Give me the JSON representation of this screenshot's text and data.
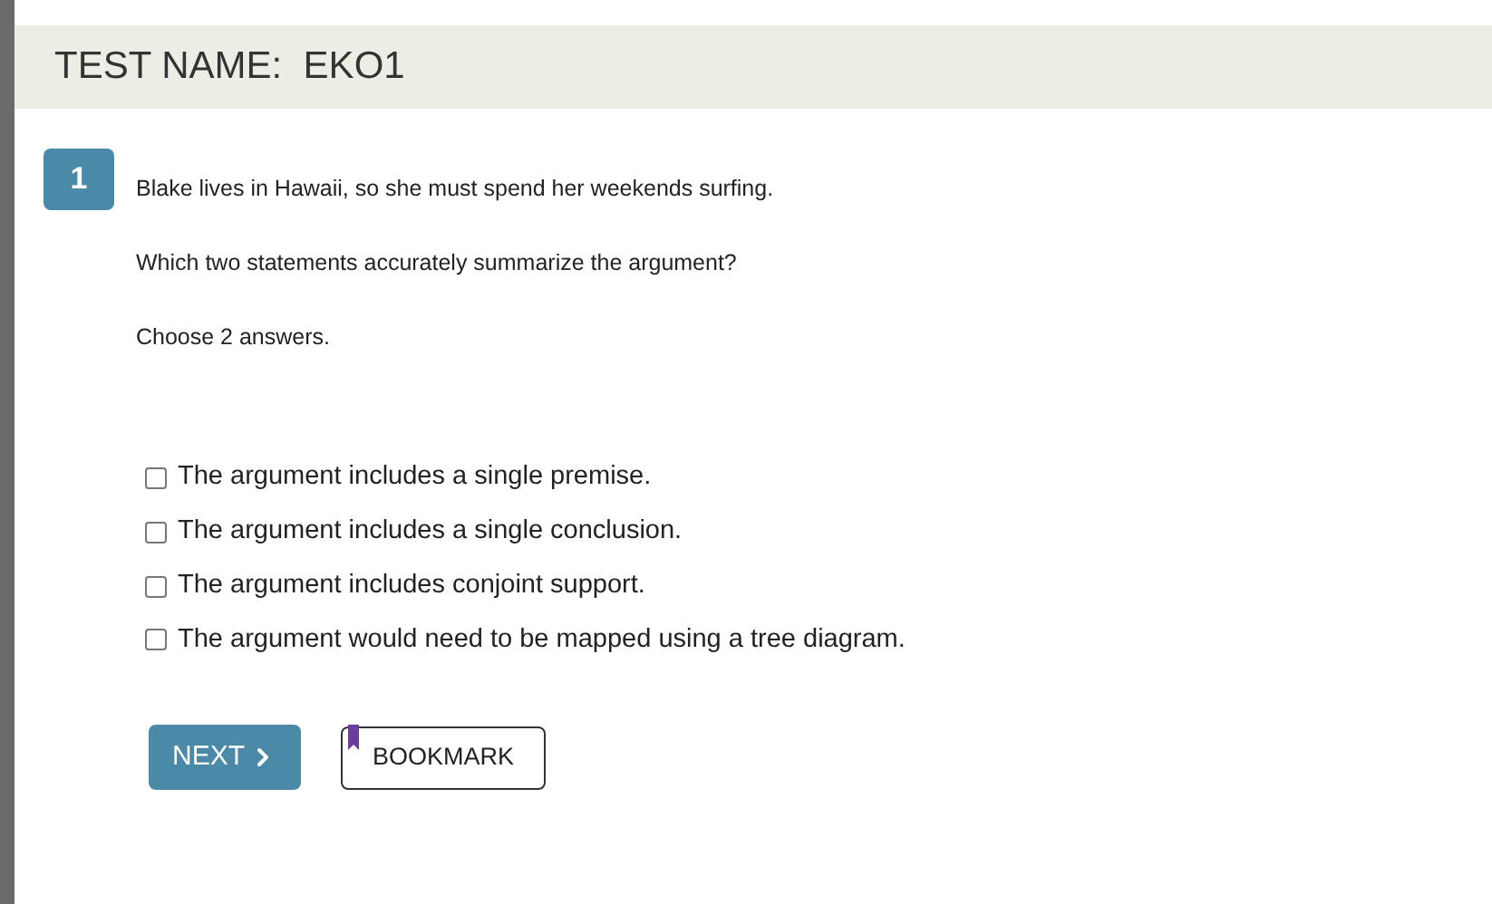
{
  "test_name": "TEST NAME:  EKO1",
  "question": {
    "number": "1",
    "prompt": "Blake lives in Hawaii, so she must spend her weekends surfing.",
    "question": "Which two statements accurately summarize the argument?",
    "instruction": "Choose 2 answers."
  },
  "options": [
    {
      "label": "The argument includes a single premise.",
      "checked": false
    },
    {
      "label": "The argument includes a single conclusion.",
      "checked": false
    },
    {
      "label": "The argument includes conjoint support.",
      "checked": false
    },
    {
      "label": "The argument would need to be mapped using a tree diagram.",
      "checked": false
    }
  ],
  "buttons": {
    "next": "NEXT",
    "bookmark": "BOOKMARK"
  }
}
